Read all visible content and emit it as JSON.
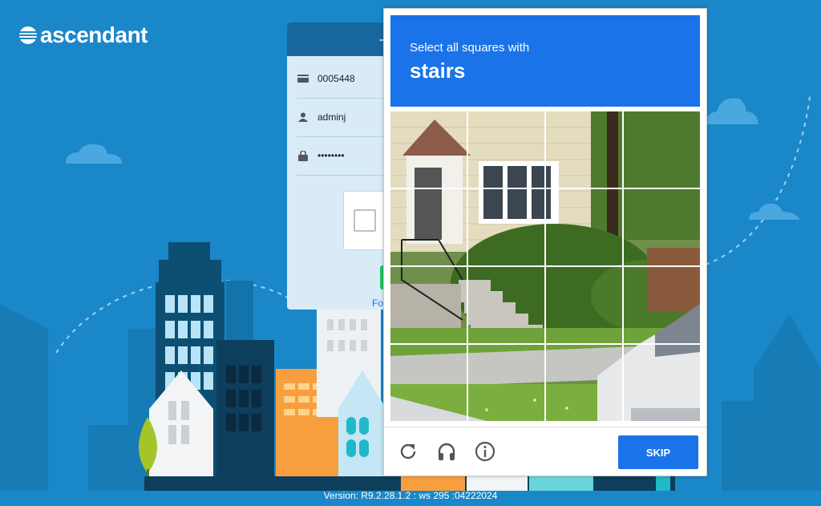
{
  "brand": {
    "name": "ascendant"
  },
  "login": {
    "account_number": "0005448",
    "username": "adminj",
    "password_masked": "••••••••",
    "forgot_link_partial": "Fo",
    "signin_icon": "sign-in-icon"
  },
  "challenge": {
    "instruction": "Select all squares with",
    "target": "stairs",
    "skip_label": "SKIP",
    "icons": [
      "refresh-icon",
      "headphones-icon",
      "info-icon"
    ],
    "grid": {
      "rows": 4,
      "cols": 4
    }
  },
  "footer": {
    "version": "Version: R9.2.28.1.2 : ws 295 :04222024"
  },
  "colors": {
    "background": "#1a87c8",
    "accent": "#1a73e8",
    "login_header": "#17679e"
  }
}
